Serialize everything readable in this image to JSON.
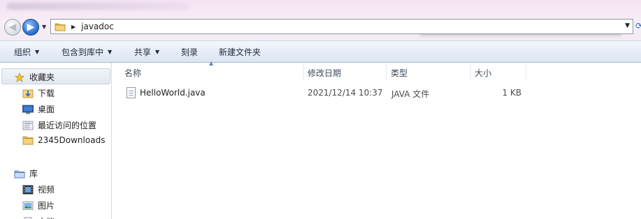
{
  "address": {
    "path": "javadoc"
  },
  "toolbar": {
    "organize_label": "组织",
    "include_in_library_label": "包含到库中",
    "share_label": "共享",
    "burn_label": "刻录",
    "new_folder_label": "新建文件夹"
  },
  "sidebar": {
    "favorites_label": "收藏夹",
    "favorites": [
      {
        "label": "下载",
        "icon": "downloads-folder-icon"
      },
      {
        "label": "桌面",
        "icon": "desktop-icon"
      },
      {
        "label": "最近访问的位置",
        "icon": "recent-places-icon"
      },
      {
        "label": "2345Downloads",
        "icon": "folder-icon"
      }
    ],
    "libraries_label": "库",
    "libraries": [
      {
        "label": "视频",
        "icon": "video-library-icon"
      },
      {
        "label": "图片",
        "icon": "pictures-library-icon"
      },
      {
        "label": "文档",
        "icon": "documents-library-icon"
      }
    ]
  },
  "columns": {
    "name": "名称",
    "modified": "修改日期",
    "type": "类型",
    "size": "大小"
  },
  "files": [
    {
      "name": "HelloWorld.java",
      "modified": "2021/12/14 10:37",
      "type": "JAVA 文件",
      "size": "1 KB"
    }
  ],
  "colors": {
    "accent": "#2f6fd0",
    "folder": "#e8b94a"
  }
}
